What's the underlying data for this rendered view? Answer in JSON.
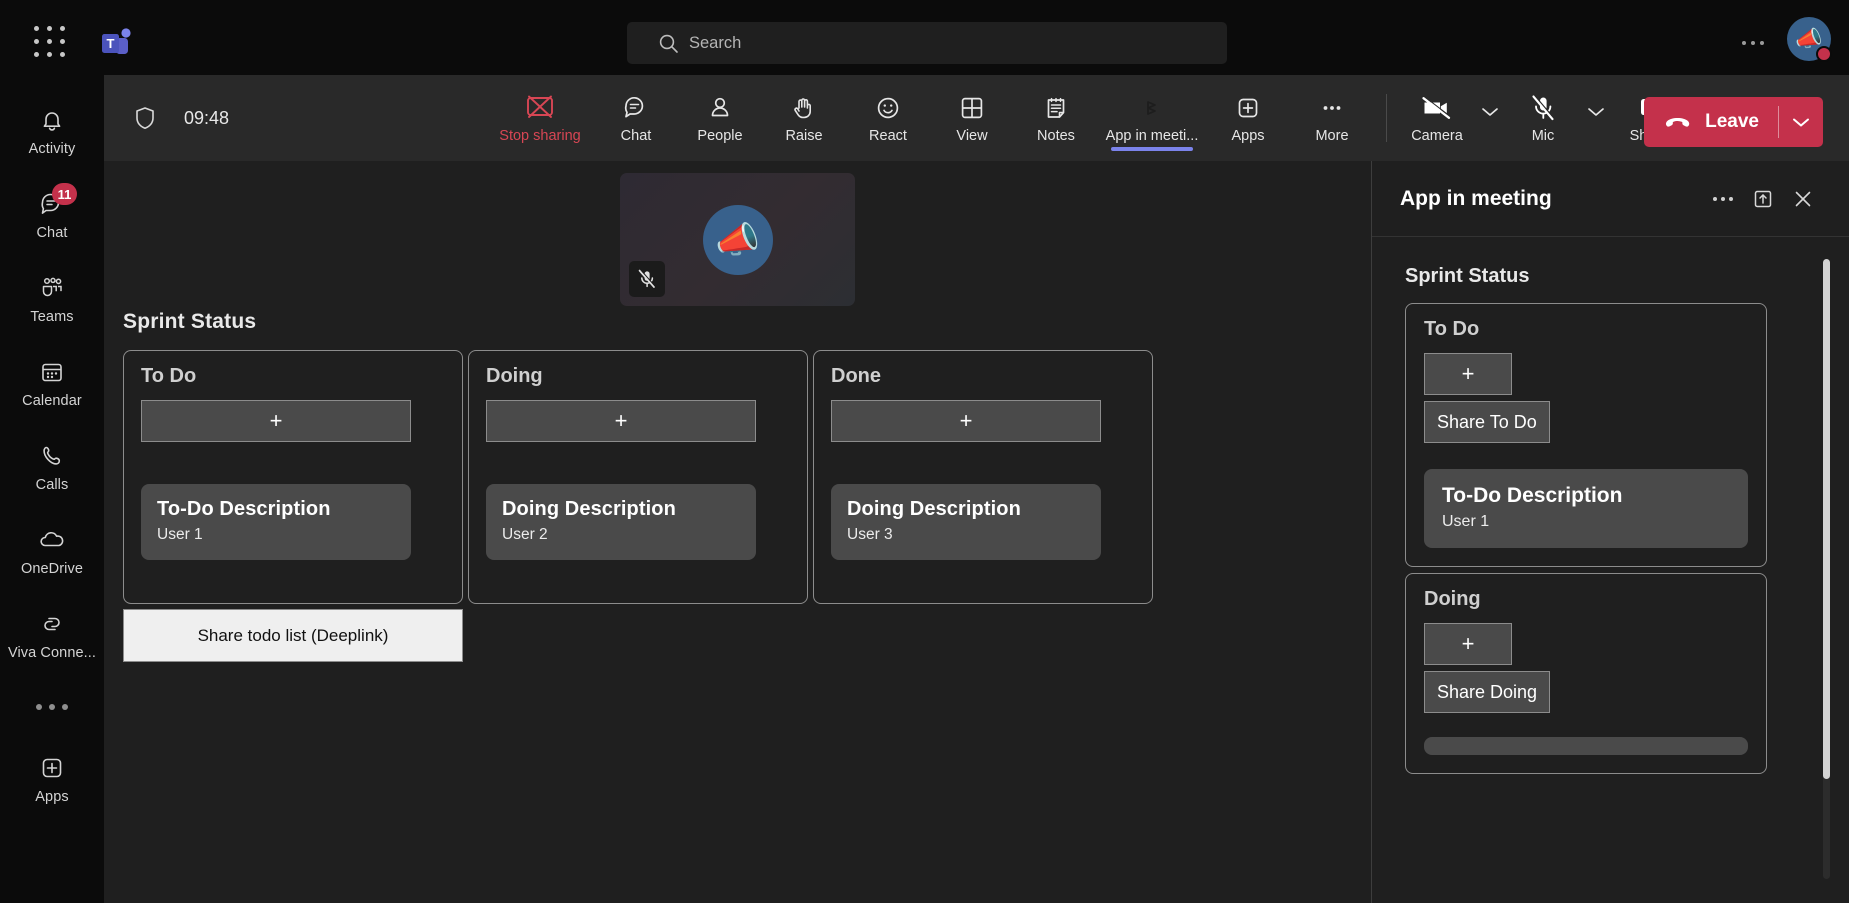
{
  "titlebar": {
    "waffle_name": "app-launcher",
    "logo_name": "teams-logo",
    "search": {
      "placeholder": "Search",
      "value": ""
    },
    "more_label": "…",
    "avatar_emoji": "📣"
  },
  "rail": {
    "items": [
      {
        "label": "Activity",
        "icon": "bell-icon",
        "badge": ""
      },
      {
        "label": "Chat",
        "icon": "chat-icon",
        "badge": "11"
      },
      {
        "label": "Teams",
        "icon": "teams-icon",
        "badge": ""
      },
      {
        "label": "Calendar",
        "icon": "calendar-icon",
        "badge": ""
      },
      {
        "label": "Calls",
        "icon": "phone-icon",
        "badge": ""
      },
      {
        "label": "OneDrive",
        "icon": "cloud-icon",
        "badge": ""
      },
      {
        "label": "Viva Conne...",
        "icon": "viva-icon",
        "badge": ""
      }
    ],
    "more_label": "",
    "apps_label": "Apps"
  },
  "meetbar": {
    "shield_name": "shield-icon",
    "timer": "09:48",
    "tools": [
      {
        "label": "Stop sharing",
        "icon": "stop-sharing-icon",
        "danger": true,
        "active": false
      },
      {
        "label": "Chat",
        "icon": "chat-icon",
        "danger": false,
        "active": false
      },
      {
        "label": "People",
        "icon": "people-icon",
        "danger": false,
        "active": false
      },
      {
        "label": "Raise",
        "icon": "raise-hand-icon",
        "danger": false,
        "active": false
      },
      {
        "label": "React",
        "icon": "react-icon",
        "danger": false,
        "active": false
      },
      {
        "label": "View",
        "icon": "view-icon",
        "danger": false,
        "active": false
      },
      {
        "label": "Notes",
        "icon": "notes-icon",
        "danger": false,
        "active": false
      },
      {
        "label": "App in meeti...",
        "icon": "app-in-meeting-icon",
        "danger": false,
        "active": true
      },
      {
        "label": "Apps",
        "icon": "apps-plus-icon",
        "danger": false,
        "active": false
      },
      {
        "label": "More",
        "icon": "more-icon",
        "danger": false,
        "active": false
      }
    ],
    "camera": {
      "label": "Camera",
      "icon": "camera-off-icon"
    },
    "mic": {
      "label": "Mic",
      "icon": "mic-off-icon"
    },
    "share": {
      "label": "Share",
      "icon": "share-up-icon"
    },
    "leave": {
      "label": "Leave",
      "icon": "hangup-icon",
      "color": "#c4314b"
    },
    "active_underline_color": "#7b83eb"
  },
  "stage": {
    "tile": {
      "avatar_emoji": "📣",
      "muted_icon": "mic-off-icon"
    },
    "board": {
      "title": "Sprint Status",
      "add_label": "+",
      "columns": [
        {
          "title": "To Do",
          "cards": [
            {
              "title": "To-Do Description",
              "user": "User 1"
            }
          ]
        },
        {
          "title": "Doing",
          "cards": [
            {
              "title": "Doing Description",
              "user": "User 2"
            }
          ]
        },
        {
          "title": "Done",
          "cards": [
            {
              "title": "Doing Description",
              "user": "User 3"
            }
          ]
        }
      ]
    },
    "deeplink_label": "Share todo list (Deeplink)"
  },
  "panel": {
    "title": "App in meeting",
    "more_label": "…",
    "popout_name": "pop-out-icon",
    "close_name": "close-icon",
    "board": {
      "title": "Sprint Status",
      "add_label": "+",
      "columns": [
        {
          "title": "To Do",
          "share_label": "Share To Do",
          "cards": [
            {
              "title": "To-Do Description",
              "user": "User 1"
            }
          ]
        },
        {
          "title": "Doing",
          "share_label": "Share Doing",
          "cards": []
        }
      ]
    }
  }
}
